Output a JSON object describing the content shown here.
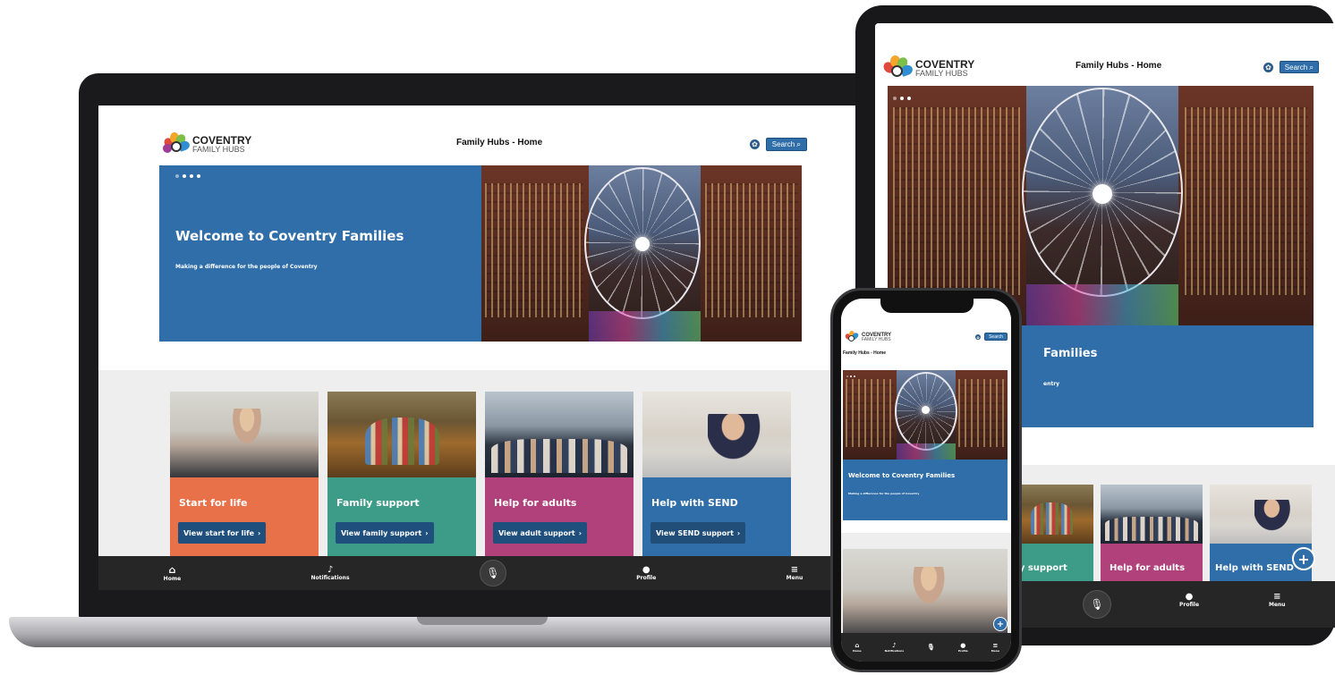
{
  "app": {
    "logo_line1": "COVENTRY",
    "logo_line2": "FAMILY HUBS",
    "page_title": "Family Hubs - Home",
    "search_label": "Search"
  },
  "hero": {
    "title": "Welcome to Coventry Families",
    "subtitle": "Making a difference for the people of Coventry",
    "tablet_title_fragment": "Families",
    "tablet_subtitle_fragment": "entry",
    "slide_count": 4,
    "active_slide": 1
  },
  "cards": [
    {
      "title": "Start for life",
      "button": "View start for life",
      "color": "#e8714a"
    },
    {
      "title": "Family support",
      "button": "View family support",
      "color": "#3d9c87"
    },
    {
      "title": "Help for adults",
      "button": "View adult support",
      "color": "#b0417a"
    },
    {
      "title": "Help with SEND",
      "button": "View SEND support",
      "color": "#2f6ea8"
    }
  ],
  "tablet_card_fragments": {
    "family": "ily support",
    "adults": "Help for adults",
    "send": "Help with SEND"
  },
  "nav": {
    "home": "Home",
    "notifications": "Notifications",
    "profile": "Profile",
    "menu": "Menu"
  },
  "icons": {
    "settings": "gear-icon",
    "search": "magnifier-icon",
    "home": "home-icon",
    "bell": "bell-icon",
    "mic": "microphone-icon",
    "profile": "person-icon",
    "menu": "hamburger-icon",
    "fab": "plus-icon"
  },
  "colors": {
    "brand_blue": "#2f6ea8",
    "nav_dark": "#262626",
    "content_bg": "#eeeeee"
  }
}
